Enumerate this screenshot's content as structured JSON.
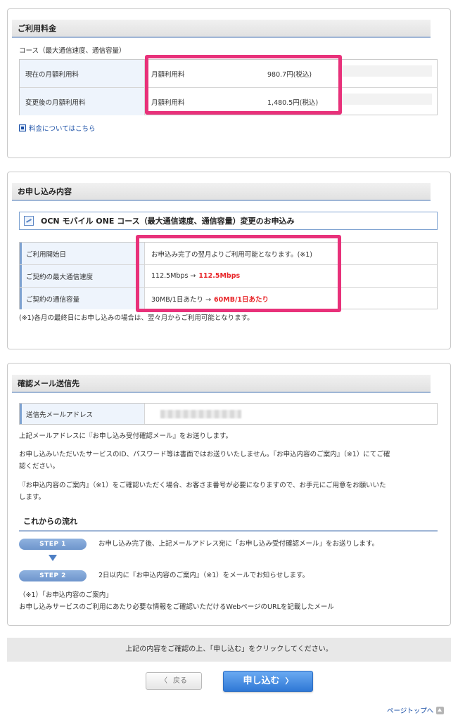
{
  "fee": {
    "title": "ご利用料金",
    "course_label": "コース（最大通信速度、通信容量）",
    "rows": [
      {
        "label": "現在の月額利用料",
        "item": "月額利用料",
        "price": "980.7円(税込)"
      },
      {
        "label": "変更後の月額利用料",
        "item": "月額利用料",
        "price": "1,480.5円(税込)"
      }
    ],
    "link": "料金についてはこちら"
  },
  "application": {
    "title": "お申し込み内容",
    "course_title": "OCN モバイル ONE コース（最大通信速度、通信容量）変更のお申込み",
    "rows": [
      {
        "label": "ご利用開始日",
        "value": "お申込み完了の翌月よりご利用可能となります。(※1)"
      },
      {
        "label": "ご契約の最大通信速度",
        "value_before": "112.5Mbps →",
        "value_after": "112.5Mbps"
      },
      {
        "label": "ご契約の通信容量",
        "value_before": "30MB/1日あたり →",
        "value_after": "60MB/1日あたり"
      }
    ],
    "note": "(※1)各月の最終日にお申し込みの場合は、翌々月からご利用可能となります。"
  },
  "confirm_mail": {
    "title": "確認メール送信先",
    "email_label": "送信先メールアドレス",
    "email_value": "",
    "text1": "上記メールアドレスに『お申し込み受付確認メール』をお送りします。",
    "text2a": "お申し込みいただいたサービスのID、パスワード等は書面ではお送りいたしません。『お申込内容のご案内』（※1）にてご確",
    "text2b": "認ください。",
    "text3a": "『お申込内容のご案内』（※1）をご確認いただく場合、お客さま番号が必要になりますので、お手元にご用意をお願いいた",
    "text3b": "します。",
    "flow_title": "これからの流れ",
    "steps": [
      {
        "label": "STEP 1",
        "text": "お申し込み完了後、上記メールアドレス宛に「お申し込み受付確認メール」をお送りします。"
      },
      {
        "label": "STEP 2",
        "text": "2日以内に『お申込内容のご案内』（※1）をメールでお知らせします。"
      }
    ],
    "footnote1": "（※1）「お申込内容のご案内」",
    "footnote2": "お申し込みサービスのご利用にあたり必要な情報をご確認いただけるWebページのURLを記載したメール"
  },
  "actions": {
    "notice": "上記の内容をご確認の上、「申し込む」をクリックしてください。",
    "back_label": "戻る",
    "apply_label": "申し込む",
    "page_top": "ページトップへ"
  },
  "colors": {
    "highlight": "#e8317a",
    "accent_red": "#e8262a",
    "button_blue": "#2f78d6"
  }
}
